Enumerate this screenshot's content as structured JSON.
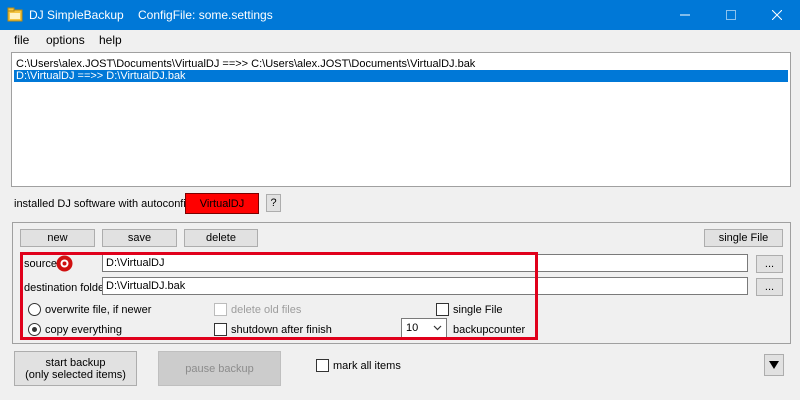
{
  "window": {
    "title": "DJ SimpleBackup",
    "config_label": "ConfigFile: some.settings"
  },
  "menu": {
    "items": [
      "file",
      "options",
      "help"
    ]
  },
  "job_list": {
    "rows": [
      {
        "text": "C:\\Users\\alex.JOST\\Documents\\VirtualDJ  ==>>  C:\\Users\\alex.JOST\\Documents\\VirtualDJ.bak",
        "selected": false
      },
      {
        "text": "D:\\VirtualDJ  ==>>  D:\\VirtualDJ.bak",
        "selected": true
      }
    ]
  },
  "autoconfig": {
    "label": "installed DJ software with autoconfig:",
    "software_button": "VirtualDJ",
    "help_button": "?",
    "software_color": "#ff0000"
  },
  "toolbar": {
    "new_label": "new",
    "save_label": "save",
    "delete_label": "delete",
    "single_file_label": "single File"
  },
  "source": {
    "label": "source",
    "value": "D:\\VirtualDJ",
    "browse_label": "..."
  },
  "destination": {
    "label": "destination folder",
    "value": "D:\\VirtualDJ.bak",
    "browse_label": "..."
  },
  "options": {
    "overwrite_label": "overwrite file, if newer",
    "copy_everything_label": "copy everything",
    "selected_mode": "copy everything",
    "delete_old_label": "delete old files",
    "delete_old_checked": false,
    "shutdown_label": "shutdown after finish",
    "shutdown_checked": false,
    "single_file_label": "single File",
    "single_file_checked": false,
    "backupcounter_value": "10",
    "backupcounter_label": "backupcounter"
  },
  "bottom": {
    "start_line1": "start backup",
    "start_line2": "(only selected items)",
    "pause_label": "pause backup",
    "mark_all_label": "mark all items",
    "mark_all_checked": false
  },
  "colors": {
    "titlebar": "#0078d7",
    "selection": "#0078d7",
    "highlight_border": "#e0001b"
  }
}
